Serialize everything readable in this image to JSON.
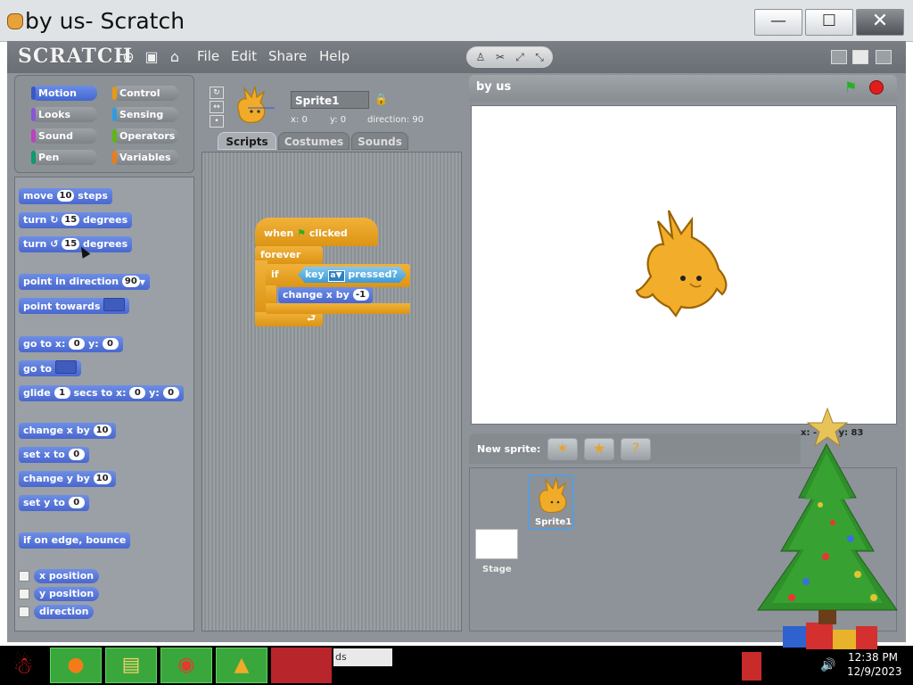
{
  "window": {
    "title": "by us- Scratch",
    "min_icon": "—",
    "max_icon": "☐",
    "close_icon": "✕"
  },
  "menubar": {
    "logo": "SCRATCH",
    "items": [
      "File",
      "Edit",
      "Share",
      "Help"
    ]
  },
  "categories": [
    "Motion",
    "Control",
    "Looks",
    "Sensing",
    "Sound",
    "Operators",
    "Pen",
    "Variables"
  ],
  "palette": {
    "move": [
      "move",
      "10",
      "steps"
    ],
    "turn_right": [
      "turn",
      "15",
      "degrees"
    ],
    "turn_left": [
      "turn",
      "15",
      "degrees"
    ],
    "point_direction": [
      "point in direction",
      "90"
    ],
    "point_towards": "point towards",
    "go_to_xy": [
      "go to x:",
      "0",
      "y:",
      "0"
    ],
    "go_to": "go to",
    "glide": [
      "glide",
      "1",
      "secs to x:",
      "0",
      "y:",
      "0"
    ],
    "change_x": [
      "change x by",
      "10"
    ],
    "set_x": [
      "set x to",
      "0"
    ],
    "change_y": [
      "change y by",
      "10"
    ],
    "set_y": [
      "set y to",
      "0"
    ],
    "bounce": "if on edge, bounce",
    "reporters": [
      "x position",
      "y position",
      "direction"
    ]
  },
  "sprite": {
    "name": "Sprite1",
    "x": "x: 0",
    "y": "y: 0",
    "direction": "direction: 90"
  },
  "tabs": [
    "Scripts",
    "Costumes",
    "Sounds"
  ],
  "script": {
    "when": "when",
    "clicked": "clicked",
    "forever": "forever",
    "if": "if",
    "key": "key",
    "key_value": "a",
    "pressed": "pressed?",
    "change_x": "change x by",
    "change_value": "-1"
  },
  "stage": {
    "title": "by us",
    "mouse_x": "x: -11",
    "mouse_y": "y: 83"
  },
  "new_sprite": {
    "label": "New sprite:"
  },
  "sprite_list": {
    "stage_label": "Stage",
    "sprite_label": "Sprite1"
  },
  "taskbar": {
    "input_text": "ds",
    "time": "12:38 PM",
    "date": "12/9/2023"
  },
  "colors": {
    "motion": "#4a67cf",
    "control": "#dc9414",
    "sensing": "#3d9ad7",
    "taskbar_app": "#3aa73c"
  }
}
